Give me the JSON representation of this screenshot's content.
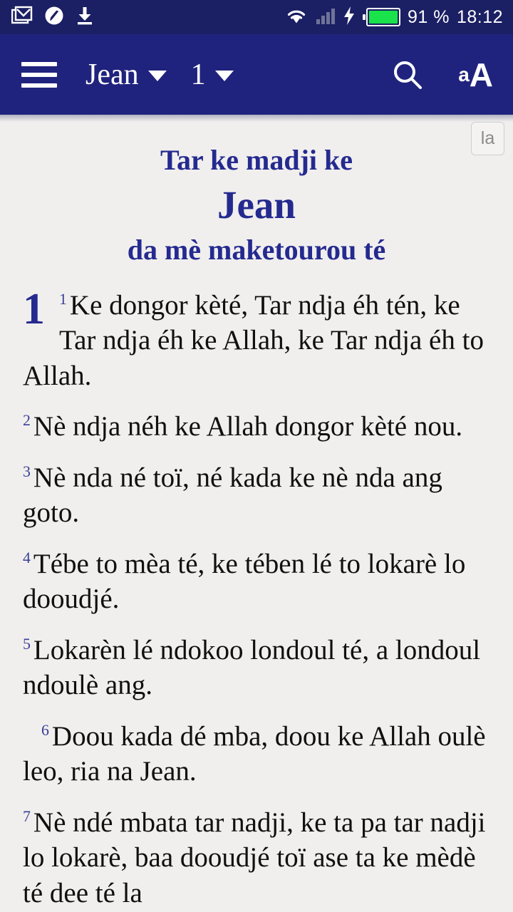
{
  "status_bar": {
    "icons_left": [
      "gmail-icon",
      "paint-icon",
      "download-icon"
    ],
    "icons_right": [
      "wifi-icon",
      "signal-icon",
      "charging-bolt-icon",
      "battery-icon"
    ],
    "battery_percent": "91 %",
    "time": "18:12",
    "background_color": "#1b1f63",
    "battery_fill_color": "#19e24a"
  },
  "app_bar": {
    "menu_icon": "hamburger-menu-icon",
    "book": "Jean",
    "chapter": "1",
    "book_caret": "chevron-down-icon",
    "chapter_caret": "chevron-down-icon",
    "search_icon": "search-icon",
    "font_size_icon_small": "a",
    "font_size_icon_big": "A",
    "background_color": "#20237d"
  },
  "content": {
    "language_button": "la",
    "accent_color": "#252a8f",
    "background_color": "#f0efee",
    "heading": {
      "line1": "Tar ke madji ke",
      "line2": "Jean",
      "line3": "da mè maketourou té"
    },
    "chapter_number": "1",
    "verses": [
      {
        "num": "1",
        "text": "Ke dongor kèté, Tar ndja éh tén, ke Tar ndja éh ke Allah, ke Tar ndja éh to Allah.",
        "indent": false
      },
      {
        "num": "2",
        "text": "Nè ndja néh ke Allah dongor kèté nou.",
        "indent": false
      },
      {
        "num": "3",
        "text": "Nè nda né toï, né kada ke nè nda ang goto.",
        "indent": false
      },
      {
        "num": "4",
        "text": "Tébe to mèa té, ke tében lé to lokarè lo dooudjé.",
        "indent": false
      },
      {
        "num": "5",
        "text": "Lokarèn lé ndokoo londoul té, a londoul ndoulè ang.",
        "indent": false
      },
      {
        "num": "6",
        "text": "Doou kada dé mba, doou ke Allah oulè leo, ria na Jean.",
        "indent": true
      },
      {
        "num": "7",
        "text": "Nè ndé mbata tar nadji, ke ta pa tar nadji lo lokarè, baa dooudjé toï ase ta ke mèdè té dee té la",
        "indent": false
      }
    ]
  }
}
